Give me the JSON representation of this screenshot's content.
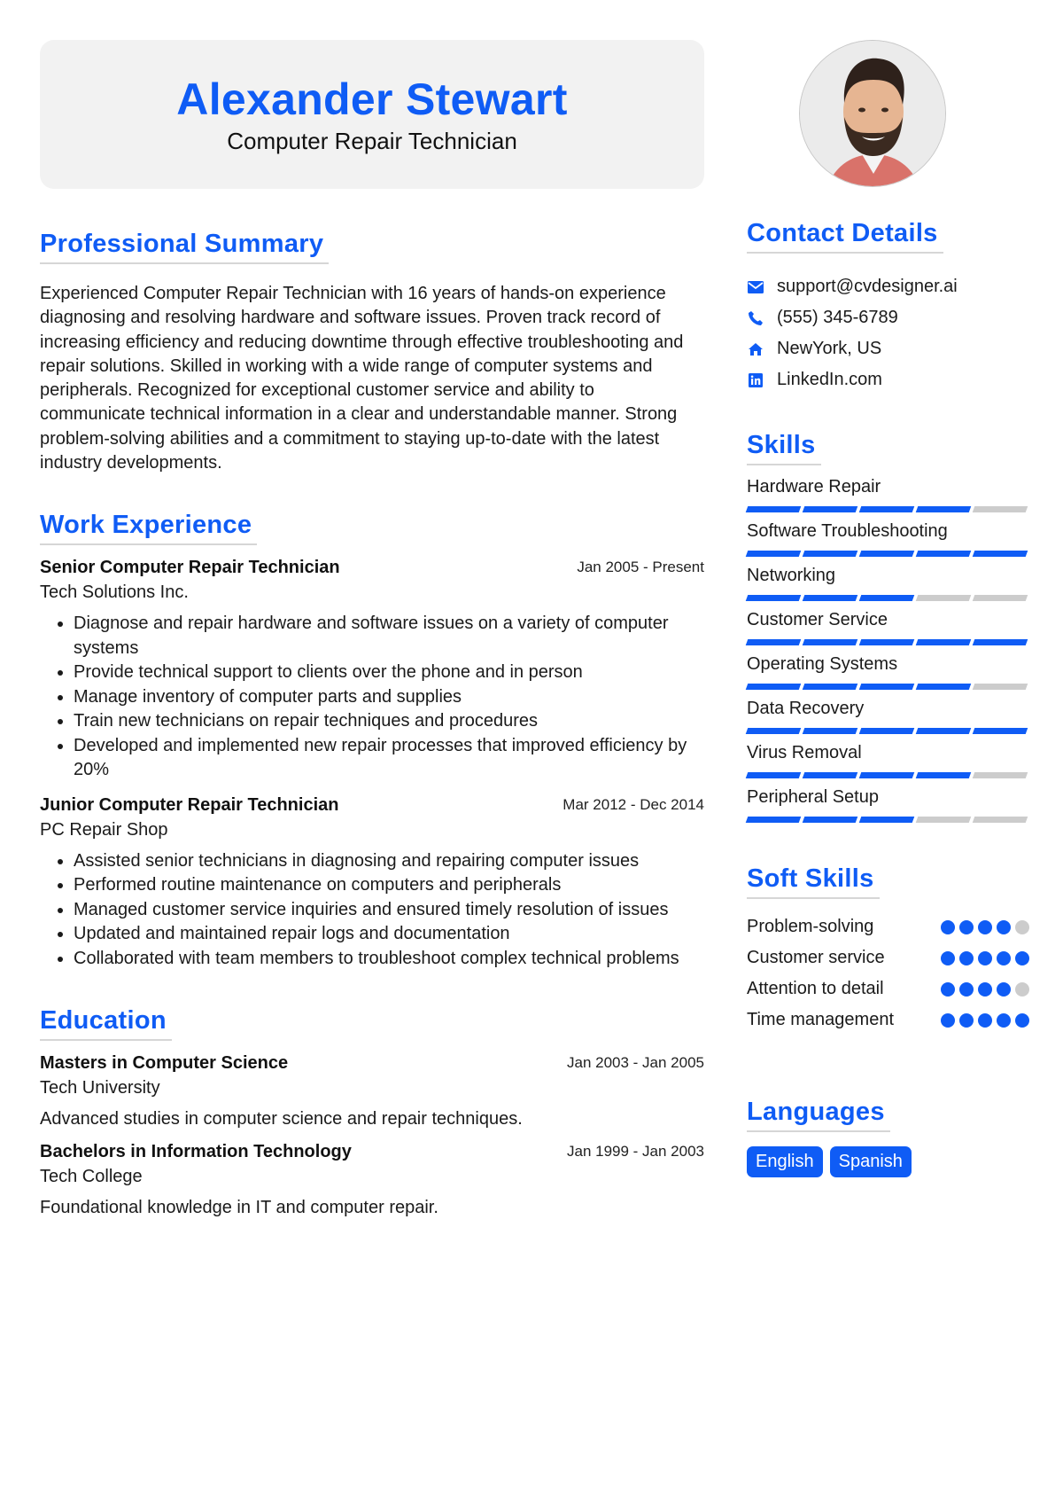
{
  "header": {
    "name": "Alexander Stewart",
    "title": "Computer Repair Technician"
  },
  "colors": {
    "accent": "#0f5cf5",
    "header_bg": "#f2f2f2",
    "inactive": "#cccccc"
  },
  "summary": {
    "heading": "Professional Summary",
    "text": "Experienced Computer Repair Technician with 16 years of hands-on experience diagnosing and resolving hardware and software issues. Proven track record of increasing efficiency and reducing downtime through effective troubleshooting and repair solutions. Skilled in working with a wide range of computer systems and peripherals. Recognized for exceptional customer service and ability to communicate technical information in a clear and understandable manner. Strong problem-solving abilities and a commitment to staying up-to-date with the latest industry developments."
  },
  "work": {
    "heading": "Work Experience",
    "jobs": [
      {
        "title": "Senior Computer Repair Technician",
        "date": "Jan 2005 - Present",
        "company": "Tech Solutions Inc.",
        "bullets": [
          "Diagnose and repair hardware and software issues on a variety of computer systems",
          "Provide technical support to clients over the phone and in person",
          "Manage inventory of computer parts and supplies",
          "Train new technicians on repair techniques and procedures",
          "Developed and implemented new repair processes that improved efficiency by 20%"
        ]
      },
      {
        "title": "Junior Computer Repair Technician",
        "date": "Mar 2012 - Dec 2014",
        "company": "PC Repair Shop",
        "bullets": [
          "Assisted senior technicians in diagnosing and repairing computer issues",
          "Performed routine maintenance on computers and peripherals",
          "Managed customer service inquiries and ensured timely resolution of issues",
          "Updated and maintained repair logs and documentation",
          "Collaborated with team members to troubleshoot complex technical problems"
        ]
      }
    ]
  },
  "education": {
    "heading": "Education",
    "items": [
      {
        "degree": "Masters in Computer Science",
        "date": "Jan 2003 - Jan 2005",
        "school": "Tech University",
        "description": "Advanced studies in computer science and repair techniques."
      },
      {
        "degree": "Bachelors in Information Technology",
        "date": "Jan 1999 - Jan 2003",
        "school": "Tech College",
        "description": "Foundational knowledge in IT and computer repair."
      }
    ]
  },
  "contact": {
    "heading": "Contact Details",
    "items": [
      {
        "icon": "envelope-icon",
        "text": "support@cvdesigner.ai"
      },
      {
        "icon": "phone-icon",
        "text": "(555) 345-6789"
      },
      {
        "icon": "home-icon",
        "text": "NewYork, US"
      },
      {
        "icon": "linkedin-icon",
        "text": "LinkedIn.com"
      }
    ]
  },
  "skills": {
    "heading": "Skills",
    "max": 5,
    "items": [
      {
        "name": "Hardware Repair",
        "level": 4
      },
      {
        "name": "Software Troubleshooting",
        "level": 5
      },
      {
        "name": "Networking",
        "level": 3
      },
      {
        "name": "Customer Service",
        "level": 5
      },
      {
        "name": "Operating Systems",
        "level": 4
      },
      {
        "name": "Data Recovery",
        "level": 5
      },
      {
        "name": "Virus Removal",
        "level": 4
      },
      {
        "name": "Peripheral Setup",
        "level": 3
      }
    ]
  },
  "soft_skills": {
    "heading": "Soft Skills",
    "max": 5,
    "items": [
      {
        "name": "Problem-solving",
        "level": 4
      },
      {
        "name": "Customer service",
        "level": 5
      },
      {
        "name": "Attention to detail",
        "level": 4
      },
      {
        "name": "Time management",
        "level": 5
      }
    ]
  },
  "languages": {
    "heading": "Languages",
    "items": [
      "English",
      "Spanish"
    ]
  }
}
